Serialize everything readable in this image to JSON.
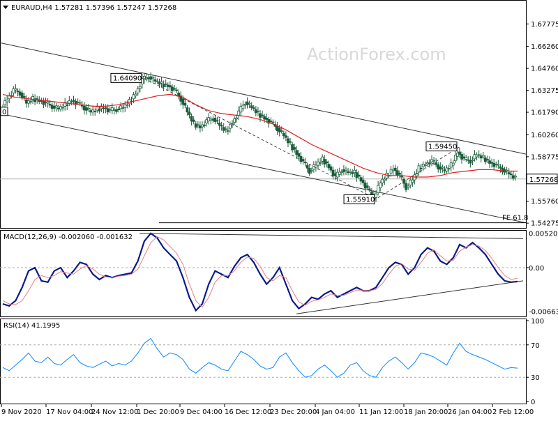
{
  "chart_data": [
    {
      "type": "candlestick",
      "title": "EURAUD,H4  1.57281 1.57396 1.57247 1.57268",
      "watermark": "ActionForex.com",
      "ylim": [
        1.5395,
        1.6935
      ],
      "y_ticks": [
        "1.67775",
        "1.66260",
        "1.64760",
        "1.63275",
        "1.61790",
        "1.60260",
        "1.58775",
        "1.57260",
        "1.55760",
        "1.54275"
      ],
      "current_price_label": "1.57268",
      "annotations": [
        {
          "text": "1.64090",
          "kind": "swing-high",
          "value": 1.6409
        },
        {
          "text": "1.59450",
          "kind": "swing-high",
          "value": 1.5945
        },
        {
          "text": "1.55910",
          "kind": "swing-low",
          "value": 1.5591
        },
        {
          "text": "FE 61.8",
          "kind": "fibonacci-expansion",
          "value": 1.543
        },
        {
          "text": "0",
          "kind": "edge-tag"
        }
      ],
      "close_series": [
        1.621,
        1.627,
        1.633,
        1.631,
        1.624,
        1.627,
        1.626,
        1.624,
        1.622,
        1.62,
        1.623,
        1.626,
        1.624,
        1.621,
        1.618,
        1.62,
        1.621,
        1.619,
        1.62,
        1.621,
        1.625,
        1.631,
        1.64,
        1.642,
        1.639,
        1.637,
        1.636,
        1.633,
        1.627,
        1.618,
        1.61,
        1.608,
        1.612,
        1.614,
        1.609,
        1.605,
        1.611,
        1.618,
        1.625,
        1.621,
        1.617,
        1.614,
        1.611,
        1.607,
        1.602,
        1.596,
        1.59,
        1.584,
        1.578,
        1.582,
        1.586,
        1.581,
        1.574,
        1.579,
        1.577,
        1.577,
        1.572,
        1.566,
        1.56,
        1.57,
        1.575,
        1.58,
        1.575,
        1.567,
        1.572,
        1.58,
        1.583,
        1.585,
        1.581,
        1.578,
        1.582,
        1.591,
        1.586,
        1.585,
        1.589,
        1.587,
        1.584,
        1.582,
        1.579,
        1.576,
        1.573
      ],
      "moving_average": [
        1.63,
        1.628,
        1.627,
        1.626,
        1.625,
        1.624,
        1.623,
        1.622,
        1.622,
        1.623,
        1.625,
        1.627,
        1.629,
        1.63,
        1.628,
        1.623,
        1.619,
        1.617,
        1.616,
        1.615,
        1.613,
        1.61,
        1.606,
        1.601,
        1.596,
        1.592,
        1.588,
        1.584,
        1.58,
        1.577,
        1.575,
        1.575,
        1.574,
        1.574,
        1.575,
        1.577,
        1.578,
        1.579,
        1.579,
        1.578,
        1.578
      ],
      "upper_channel": [
        1.665,
        1.5895
      ],
      "lower_channel": [
        1.617,
        1.543
      ],
      "fe_level": 1.543,
      "x_ticks": [
        "9 Nov 2020",
        "17 Nov 04:00",
        "24 Nov 12:00",
        "1 Dec 20:00",
        "9 Dec 04:00",
        "16 Dec 12:00",
        "23 Dec 20:00",
        "4 Jan 04:00",
        "11 Jan 12:00",
        "18 Jan 20:00",
        "26 Jan 04:00",
        "2 Feb 12:00"
      ]
    },
    {
      "type": "line",
      "title": "MACD(12,26,9) -0.002060 -0.001632",
      "ylim": [
        -0.0074,
        0.0056
      ],
      "y_ticks": [
        "0.005208",
        "0.00",
        "0.00",
        "-0.006631"
      ],
      "series": [
        {
          "role": "macd",
          "values": [
            -0.0055,
            -0.0058,
            -0.005,
            -0.003,
            -0.0005,
            0.0,
            -0.002,
            -0.0022,
            -0.0005,
            0.0,
            -0.0015,
            -0.0005,
            0.0008,
            0.0005,
            -0.001,
            -0.0018,
            -0.0012,
            -0.0015,
            -0.0012,
            -0.001,
            -0.0008,
            0.001,
            0.004,
            0.0052,
            0.0045,
            0.003,
            0.002,
            0.001,
            -0.0015,
            -0.0045,
            -0.0065,
            -0.0055,
            -0.0025,
            -0.0005,
            -0.001,
            -0.0015,
            0.0002,
            0.0015,
            0.002,
            0.0008,
            -0.001,
            -0.0025,
            -0.0015,
            0.0,
            -0.0025,
            -0.005,
            -0.0062,
            -0.0055,
            -0.0045,
            -0.0048,
            -0.004,
            -0.0035,
            -0.0045,
            -0.004,
            -0.0035,
            -0.003,
            -0.0035,
            -0.0035,
            -0.003,
            -0.0015,
            0.0,
            0.0008,
            0.0005,
            -0.001,
            0.0,
            0.002,
            0.003,
            0.0025,
            0.001,
            0.0005,
            0.0015,
            0.0035,
            0.003,
            0.0038,
            0.003,
            0.002,
            0.0005,
            -0.001,
            -0.002,
            -0.0022,
            -0.0021
          ]
        },
        {
          "role": "signal",
          "values": [
            -0.005,
            -0.0055,
            -0.0056,
            -0.005,
            -0.0035,
            -0.0018,
            -0.0012,
            -0.0015,
            -0.0012,
            -0.0006,
            -0.0008,
            -0.001,
            -0.0002,
            0.0003,
            -0.0002,
            -0.001,
            -0.0014,
            -0.0015,
            -0.0013,
            -0.0012,
            -0.001,
            -0.0002,
            0.0018,
            0.0038,
            0.0047,
            0.0042,
            0.0032,
            0.0022,
            0.0005,
            -0.0025,
            -0.005,
            -0.006,
            -0.0045,
            -0.0022,
            -0.0012,
            -0.0012,
            -0.0005,
            0.0008,
            0.0016,
            0.0014,
            0.0002,
            -0.0015,
            -0.002,
            -0.0012,
            -0.0015,
            -0.0035,
            -0.0052,
            -0.0057,
            -0.0051,
            -0.0049,
            -0.0045,
            -0.004,
            -0.0042,
            -0.0042,
            -0.0038,
            -0.0034,
            -0.0034,
            -0.0035,
            -0.0033,
            -0.0024,
            -0.001,
            0.0002,
            0.0006,
            -0.0002,
            -0.0004,
            0.0008,
            0.0022,
            0.0027,
            0.0018,
            0.001,
            0.0011,
            0.0025,
            0.0031,
            0.0035,
            0.0033,
            0.0026,
            0.0014,
            0.0,
            -0.0012,
            -0.0018,
            -0.0016
          ]
        }
      ]
    },
    {
      "type": "line",
      "title": "RSI(14) 41.1995",
      "ylim": [
        0,
        100
      ],
      "y_ticks": [
        100,
        70,
        30,
        0
      ],
      "levels": [
        70,
        30
      ],
      "values": [
        42,
        38,
        45,
        52,
        60,
        50,
        48,
        55,
        47,
        45,
        52,
        58,
        48,
        44,
        42,
        46,
        50,
        44,
        47,
        45,
        50,
        60,
        72,
        78,
        65,
        55,
        60,
        58,
        52,
        40,
        35,
        42,
        48,
        45,
        40,
        38,
        50,
        62,
        58,
        52,
        44,
        40,
        42,
        55,
        60,
        48,
        38,
        30,
        32,
        40,
        45,
        38,
        30,
        35,
        45,
        48,
        38,
        32,
        30,
        42,
        50,
        55,
        48,
        40,
        48,
        60,
        58,
        55,
        50,
        45,
        60,
        72,
        62,
        58,
        55,
        52,
        48,
        44,
        40,
        42,
        41.2
      ]
    }
  ]
}
